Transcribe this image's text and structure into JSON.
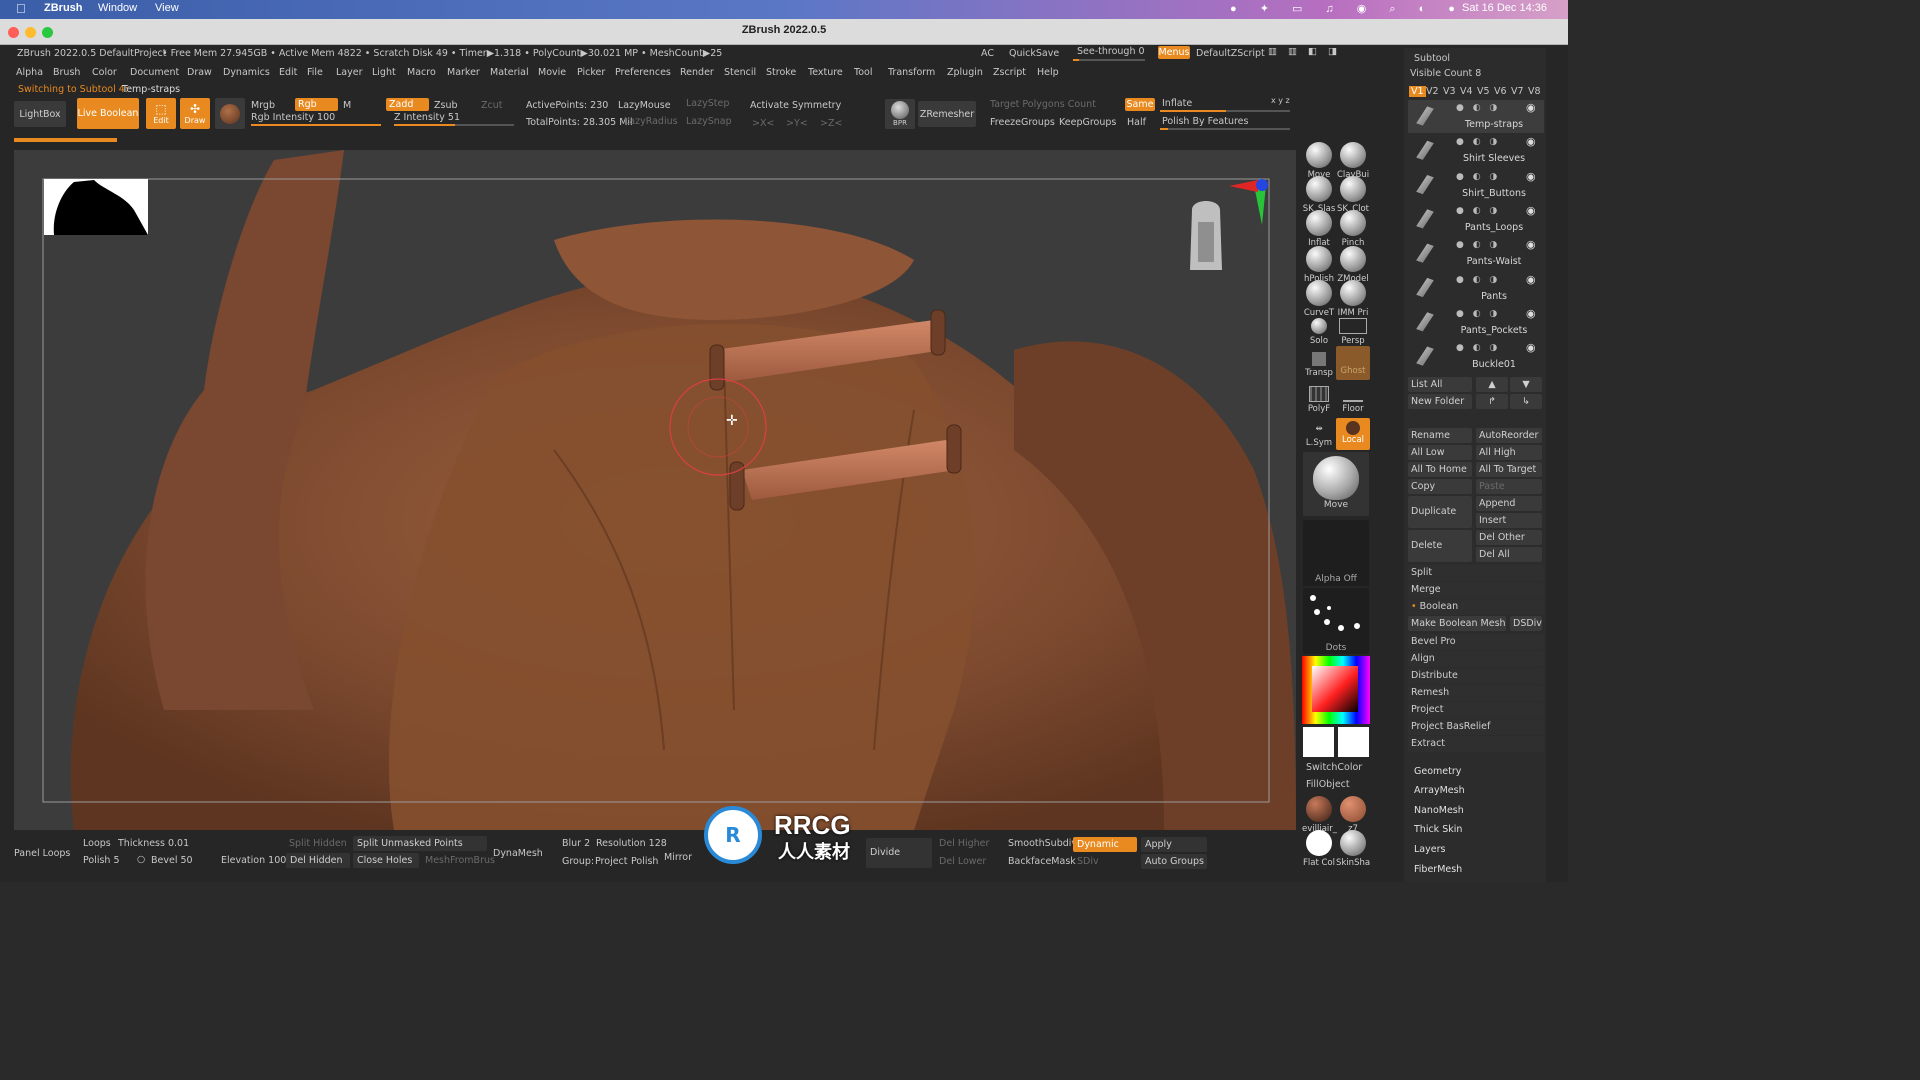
{
  "mac_menubar": {
    "app_name": "ZBrush",
    "menus": [
      "Window",
      "View"
    ],
    "clock": "Sat 16 Dec  14:36"
  },
  "window": {
    "title": "ZBrush 2022.0.5"
  },
  "info_bar": {
    "project": "ZBrush 2022.0.5 DefaultProject",
    "stats": "• Free Mem 27.945GB • Active Mem 4822 • Scratch Disk 49 •  Timer▶1.318 • PolyCount▶30.021 MP • MeshCount▶25",
    "ac": "AC",
    "quicksave": "QuickSave",
    "see_through": "See-through  0",
    "menus": "Menus",
    "script": "DefaultZScript"
  },
  "main_menu": [
    "Alpha",
    "Brush",
    "Color",
    "Document",
    "Draw",
    "Dynamics",
    "Edit",
    "File",
    "Layer",
    "Light",
    "Macro",
    "Marker",
    "Material",
    "Movie",
    "Picker",
    "Preferences",
    "Render",
    "Stencil",
    "Stroke",
    "Texture",
    "Tool",
    "Transform",
    "Zplugin",
    "Zscript",
    "Help"
  ],
  "status": {
    "switching": "Switching to Subtool 4:",
    "subtool_name": "Temp-straps"
  },
  "toolbar": {
    "lightbox": "LightBox",
    "live_boolean": "Live Boolean",
    "edit": "Edit",
    "draw": "Draw",
    "mrgb": "Mrgb",
    "rgb": "Rgb",
    "m": "M",
    "rgb_intensity": "Rgb Intensity 100",
    "zadd": "Zadd",
    "zsub": "Zsub",
    "zcut": "Zcut",
    "z_intensity": "Z Intensity 51",
    "z_intensity_value": 51,
    "active_points": "ActivePoints: 230",
    "total_points": "TotalPoints: 28.305 Mil",
    "lazymouse": "LazyMouse",
    "lazystep": "LazyStep",
    "lazyradius": "LazyRadius",
    "lazysnap": "LazySnap",
    "activate_symmetry": "Activate Symmetry",
    "sym_x": ">X<",
    "sym_y": ">Y<",
    "sym_z": ">Z<",
    "bpr": "BPR",
    "zremesher": "ZRemesher",
    "target_polygons": "Target Polygons Count",
    "same": "Same",
    "inflate": "Inflate",
    "xyz": "x y z",
    "freeze_groups": "FreezeGroups",
    "keep_groups": "KeepGroups",
    "half": "Half",
    "polish_by_features": "Polish By Features"
  },
  "shelf": {
    "tools": [
      {
        "label": "Move"
      },
      {
        "label": "ClayBui"
      },
      {
        "label": "SK_Slas"
      },
      {
        "label": "SK_Clot"
      },
      {
        "label": "Inflat"
      },
      {
        "label": "Pinch"
      },
      {
        "label": "hPolish"
      },
      {
        "label": "ZModel"
      },
      {
        "label": "CurveT"
      },
      {
        "label": "IMM Pri"
      }
    ],
    "solo": "Solo",
    "persp": "Persp",
    "transp": "Transp",
    "ghost": "Ghost",
    "polyf": "PolyF",
    "floor": "Floor",
    "lsym": "L.Sym",
    "local": "Local",
    "brush_name": "Move",
    "alpha": "Alpha Off",
    "stroke": "Dots",
    "switch_color": "SwitchColor",
    "fill_object": "FillObject",
    "mat1": "evilliair_",
    "mat2": "z7",
    "mat3": "Flat Col",
    "mat4": "SkinSha"
  },
  "subtool": {
    "header": "Subtool",
    "visible_count": "Visible Count 8",
    "versions": [
      "V1",
      "V2",
      "V3",
      "V4",
      "V5",
      "V6",
      "V7",
      "V8"
    ],
    "items": [
      "Temp-straps",
      "Shirt Sleeves",
      "Shirt_Buttons",
      "Pants_Loops",
      "Pants-Waist",
      "Pants",
      "Pants_Pockets",
      "Buckle01"
    ],
    "list_all": "List All",
    "new_folder": "New Folder",
    "rename": "Rename",
    "auto_reorder": "AutoReorder",
    "all_low": "All Low",
    "all_high": "All High",
    "all_to_home": "All To Home",
    "all_to_target": "All To Target",
    "copy": "Copy",
    "paste": "Paste",
    "duplicate": "Duplicate",
    "append": "Append",
    "insert": "Insert",
    "delete": "Delete",
    "del_other": "Del Other",
    "del_all": "Del All",
    "split": "Split",
    "merge": "Merge",
    "boolean": "Boolean",
    "make_boolean_mesh": "Make Boolean Mesh",
    "dsdiv": "DSDiv",
    "bevel_pro": "Bevel Pro",
    "align": "Align",
    "distribute": "Distribute",
    "remesh": "Remesh",
    "project": "Project",
    "project_basrelief": "Project BasRelief",
    "extract": "Extract",
    "geometry": "Geometry",
    "arraymesh": "ArrayMesh",
    "nanomesh": "NanoMesh",
    "thick_skin": "Thick Skin",
    "layers": "Layers",
    "fibermesh": "FiberMesh"
  },
  "bottom": {
    "panel_loops": "Panel Loops",
    "loops": "Loops",
    "thickness": "Thickness 0.01",
    "polish": "Polish 5",
    "bevel": "Bevel 50",
    "elevation": "Elevation 100",
    "split_hidden": "Split Hidden",
    "split_unmasked": "Split Unmasked Points",
    "del_hidden": "Del Hidden",
    "close_holes": "Close Holes",
    "mesh_from_brush": "MeshFromBrus",
    "dynamesh": "DynaMesh",
    "blur": "Blur 2",
    "resolution": "Resolution 128",
    "group": "Group:",
    "project": "Project",
    "polish_btn": "Polish",
    "mirror": "Mirror",
    "divide": "Divide",
    "del_higher": "Del Higher",
    "del_lower": "Del Lower",
    "smooth_subdiv": "SmoothSubdiv",
    "dynamic": "Dynamic",
    "apply": "Apply",
    "backface_mask": "BackfaceMask",
    "sdiv": "SDiv",
    "auto_groups": "Auto Groups"
  },
  "watermark": {
    "brand": "RRCG",
    "sub": "人人素材"
  },
  "colors": {
    "accent": "#e88a1f",
    "clay": "#8a5236",
    "strap": "#b56b4e"
  }
}
